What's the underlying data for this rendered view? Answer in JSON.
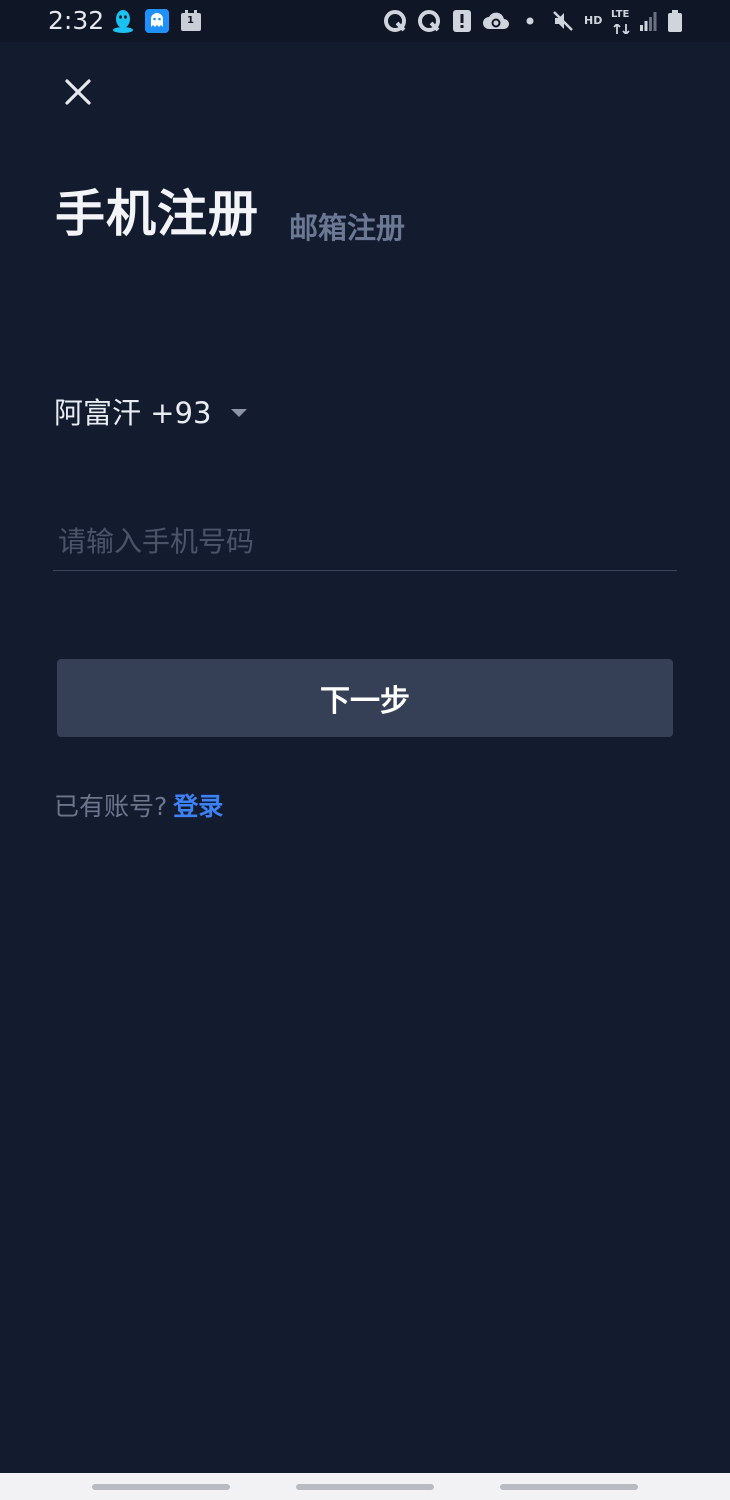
{
  "status_bar": {
    "time": "2:32",
    "notification_icons": [
      "qq-penguin-icon",
      "qq-ghost-icon",
      "calendar-icon"
    ],
    "calendar_badge": "1",
    "system_icons": [
      "q-app-icon",
      "q-app-icon",
      "alert-icon",
      "cloud-sync-icon",
      "dot-icon",
      "mute-icon",
      "hd-icon",
      "lte-icon",
      "signal-icon",
      "battery-icon"
    ],
    "hd_label": "HD",
    "lte_label": "LTE"
  },
  "header": {
    "close_icon": "close-icon"
  },
  "tabs": {
    "active_label": "手机注册",
    "inactive_label": "邮箱注册"
  },
  "country": {
    "label": "阿富汗 +93"
  },
  "phone": {
    "value": "",
    "placeholder": "请输入手机号码"
  },
  "next_button": {
    "label": "下一步"
  },
  "login": {
    "prompt": "已有账号?",
    "link": "登录"
  },
  "colors": {
    "background": "#131B2F",
    "button": "#353F56",
    "accent_link": "#3B82F6",
    "muted_text": "#6B7893"
  }
}
